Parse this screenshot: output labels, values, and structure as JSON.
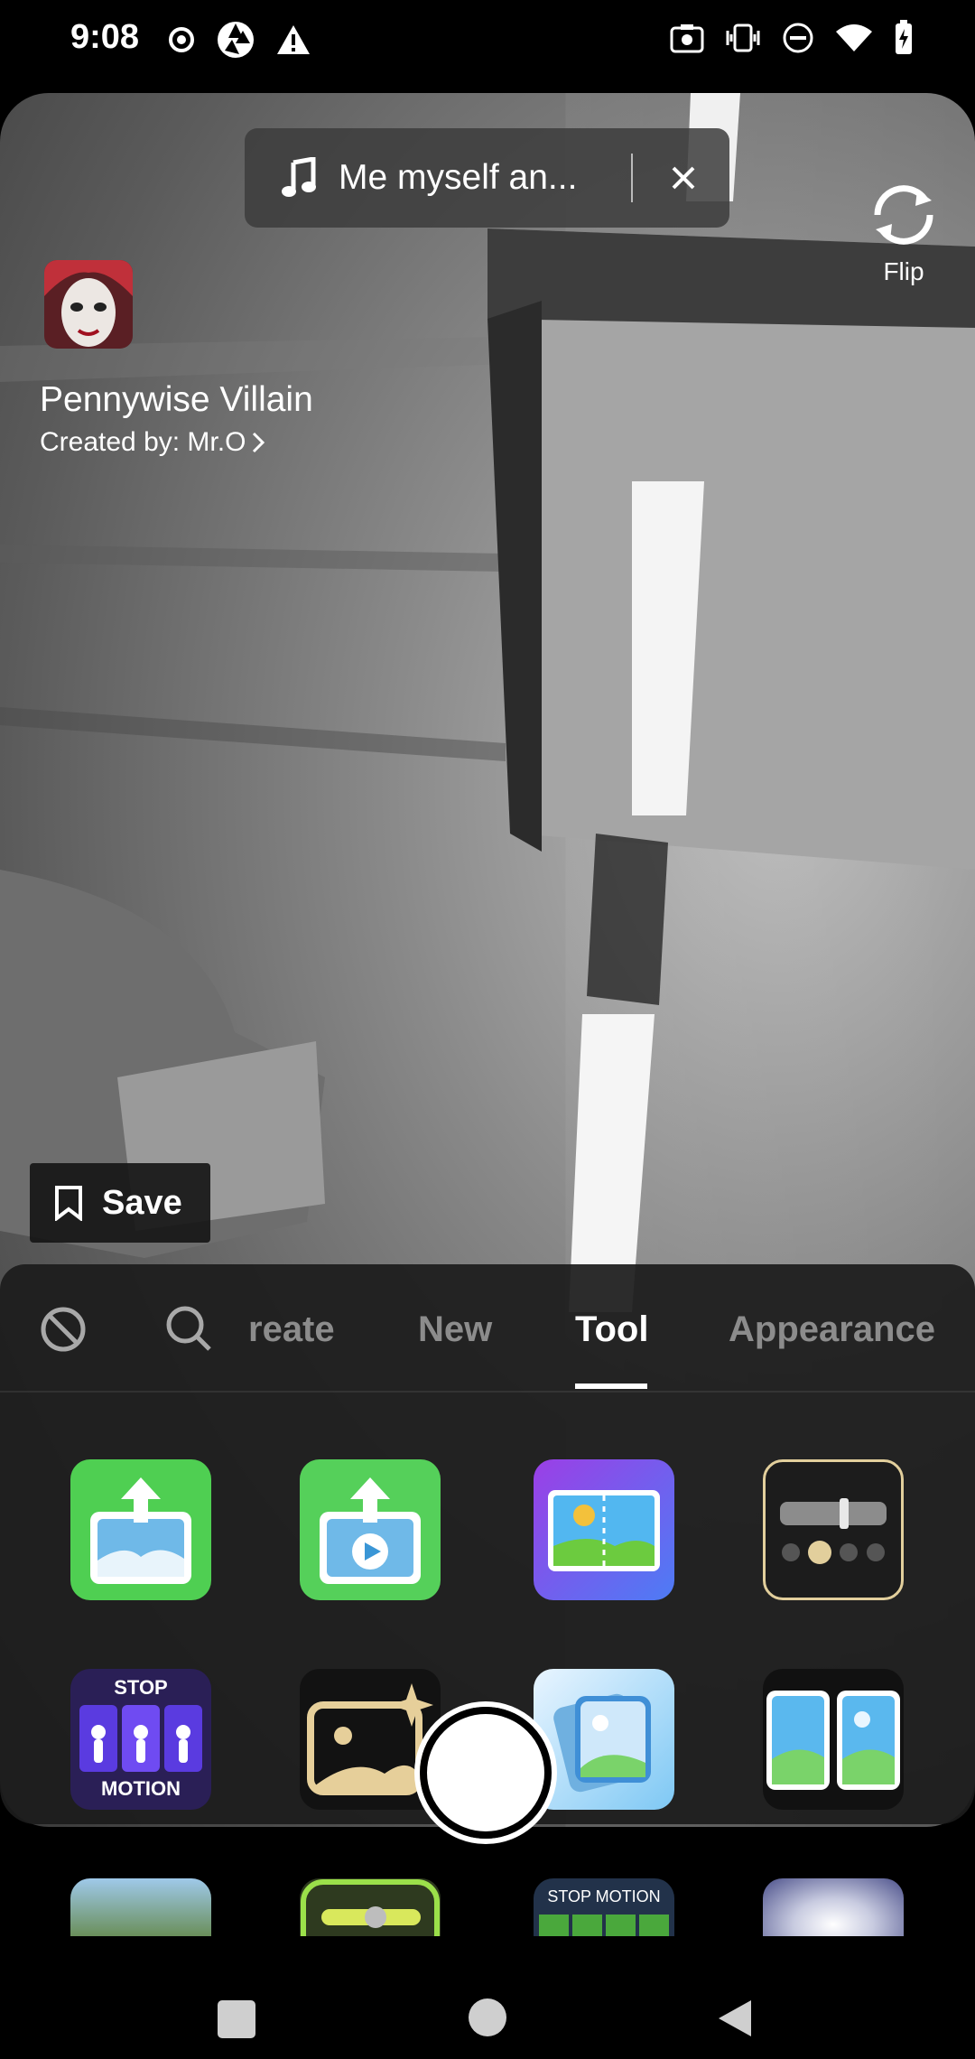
{
  "status_bar": {
    "time": "9:08",
    "left_icons": [
      "record-icon",
      "aperture-icon",
      "alert-icon"
    ],
    "right_icons": [
      "screenshot-icon",
      "vibrate-icon",
      "dnd-icon",
      "wifi-icon",
      "battery-charging-icon"
    ]
  },
  "effect": {
    "name": "Pennywise Villain",
    "creator": "Created by: Mr.O"
  },
  "music": {
    "title": "Me myself an..."
  },
  "flip": {
    "label": "Flip"
  },
  "save": {
    "label": "Save"
  },
  "tabs": [
    {
      "label": "reate"
    },
    {
      "label": "New"
    },
    {
      "label": "Tool",
      "active": true
    },
    {
      "label": "Appearance"
    }
  ],
  "grid_labels": {
    "stop_motion_top": "STOP",
    "stop_motion_bottom": "MOTION",
    "peek_stop_motion": "STOP MOTION"
  },
  "colors": {
    "green": "#4cd964",
    "purple": "#6f4bf2",
    "accent_white": "#ffffff"
  }
}
